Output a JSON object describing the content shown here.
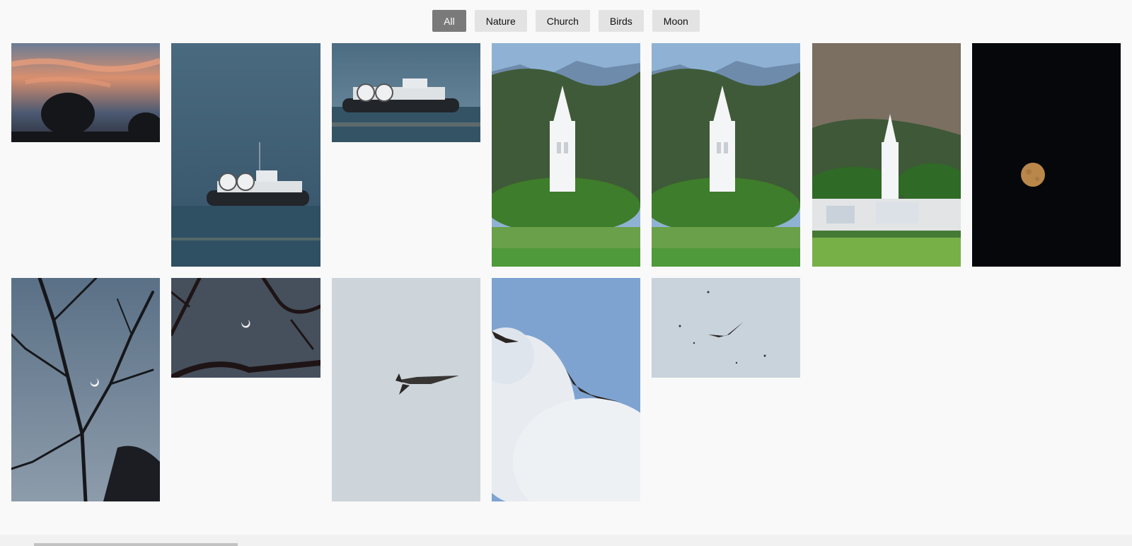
{
  "filters": [
    {
      "label": "All",
      "active": true
    },
    {
      "label": "Nature",
      "active": false
    },
    {
      "label": "Church",
      "active": false
    },
    {
      "label": "Birds",
      "active": false
    },
    {
      "label": "Moon",
      "active": false
    }
  ],
  "gallery": [
    {
      "category": "Nature",
      "subject": "sunset-tree"
    },
    {
      "category": "Nature",
      "subject": "hovercraft"
    },
    {
      "category": "Nature",
      "subject": "hovercraft"
    },
    {
      "category": "Church",
      "subject": "church-spire"
    },
    {
      "category": "Church",
      "subject": "church-spire"
    },
    {
      "category": "Church",
      "subject": "church-village"
    },
    {
      "category": "Moon",
      "subject": "full-moon"
    },
    {
      "category": "Moon",
      "subject": "crescent-branches"
    },
    {
      "category": "Moon",
      "subject": "crescent-branches"
    },
    {
      "category": "Birds",
      "subject": "bird-flying"
    },
    {
      "category": "Birds",
      "subject": "birds-clouds"
    },
    {
      "category": "Birds",
      "subject": "bird-distant"
    }
  ],
  "colors": {
    "active_filter": "#7a7a7a",
    "filter": "#e3e3e3",
    "background": "#f9f9f9"
  }
}
